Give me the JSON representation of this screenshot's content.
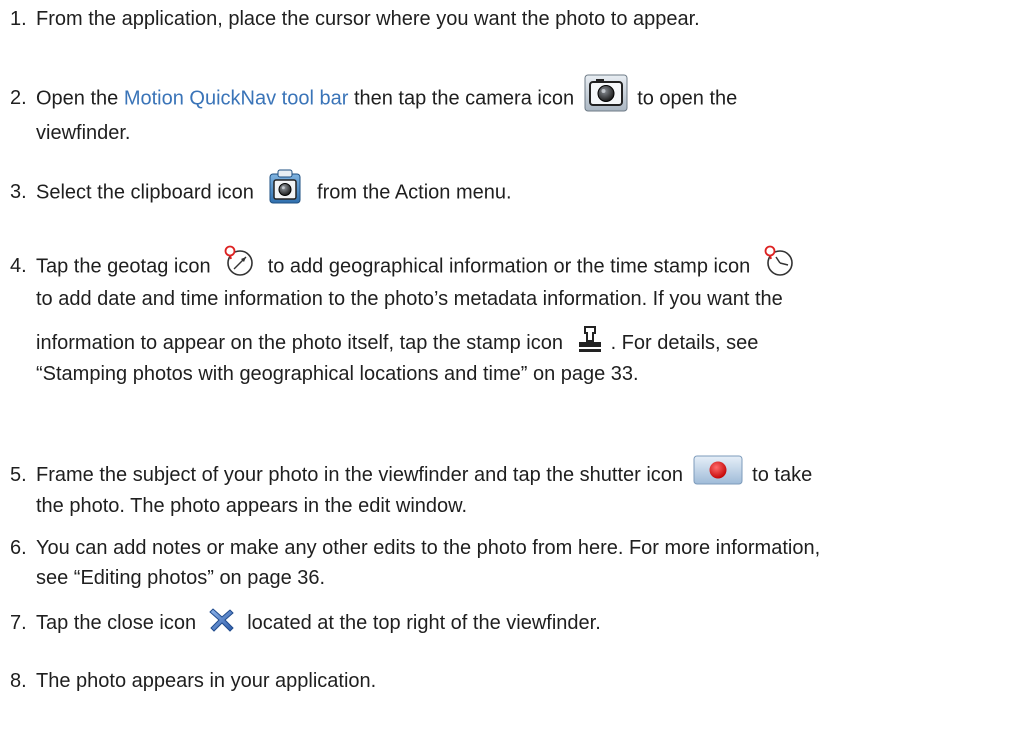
{
  "steps": [
    {
      "number": "1.",
      "line1": "From the application, place the cursor where you want the photo to appear."
    },
    {
      "number": "2.",
      "before": "Open the ",
      "link": "Motion QuickNav tool bar",
      "middle": " then tap the camera icon ",
      "after": " to open the",
      "line2": "viewfinder.",
      "icon": "camera-icon"
    },
    {
      "number": "3.",
      "before": "Select the clipboard icon ",
      "after": " from the Action menu.",
      "icon": "clipboard-icon"
    },
    {
      "number": "4.",
      "l1_before": "Tap the geotag icon ",
      "l1_middle": " to add geographical information or the time stamp icon ",
      "line2": "to add date and time information to the photo’s metadata information. If you want the",
      "l3_before": "information to appear on the photo itself, tap the stamp icon ",
      "l3_after": ". For details, see",
      "line4": "“Stamping photos with geographical locations and time” on page 33.",
      "icons": [
        "geotag-icon",
        "time-stamp-icon",
        "stamp-icon"
      ]
    },
    {
      "number": "5.",
      "before": "Frame the subject of your photo in the viewfinder and tap the shutter icon ",
      "after": " to take",
      "line2": "the photo. The photo appears in the edit window.",
      "icon": "shutter-icon"
    },
    {
      "number": "6.",
      "line1": "You can add notes or make any other edits to the photo from here. For more information,",
      "line2": "see “Editing photos” on page 36."
    },
    {
      "number": "7.",
      "before": "Tap the close icon ",
      "after": " located at the top right of the viewfinder.",
      "icon": "close-icon"
    },
    {
      "number": "8.",
      "line1": "The photo appears in your application."
    }
  ],
  "colors": {
    "text": "#1f1f1f",
    "link": "#3a74b8",
    "shutter_red": "#e3101a",
    "close_blue": "#3b6cc4"
  }
}
